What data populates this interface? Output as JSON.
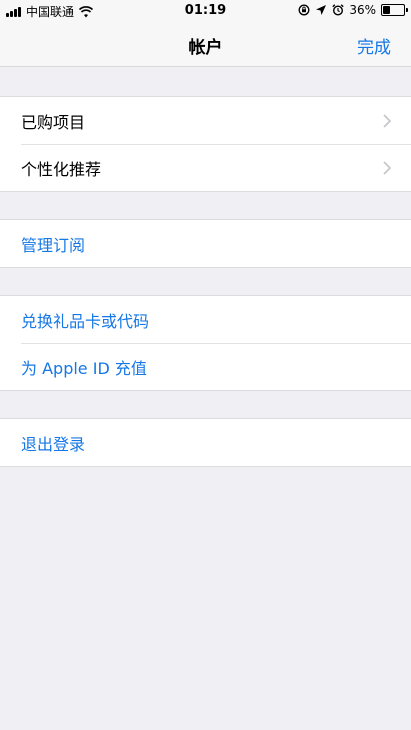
{
  "status_bar": {
    "carrier": "中国联通",
    "time": "01:19",
    "battery_percent": "36%",
    "battery_level": 0.36,
    "icons": [
      "signal-icon",
      "wifi-icon",
      "rotation-lock-icon",
      "location-icon",
      "alarm-icon",
      "battery-icon"
    ]
  },
  "nav": {
    "title": "帐户",
    "done_label": "完成"
  },
  "groups": {
    "purchases": {
      "items": [
        {
          "label": "已购项目"
        },
        {
          "label": "个性化推荐"
        }
      ]
    },
    "subscriptions": {
      "items": [
        {
          "label": "管理订阅"
        }
      ]
    },
    "redeem": {
      "items": [
        {
          "label": "兑换礼品卡或代码"
        },
        {
          "label": "为 Apple ID 充值"
        }
      ]
    },
    "logout": {
      "items": [
        {
          "label": "退出登录"
        }
      ]
    }
  },
  "colors": {
    "accent": "#1677e6",
    "background": "#efeff4",
    "cell": "#ffffff"
  }
}
